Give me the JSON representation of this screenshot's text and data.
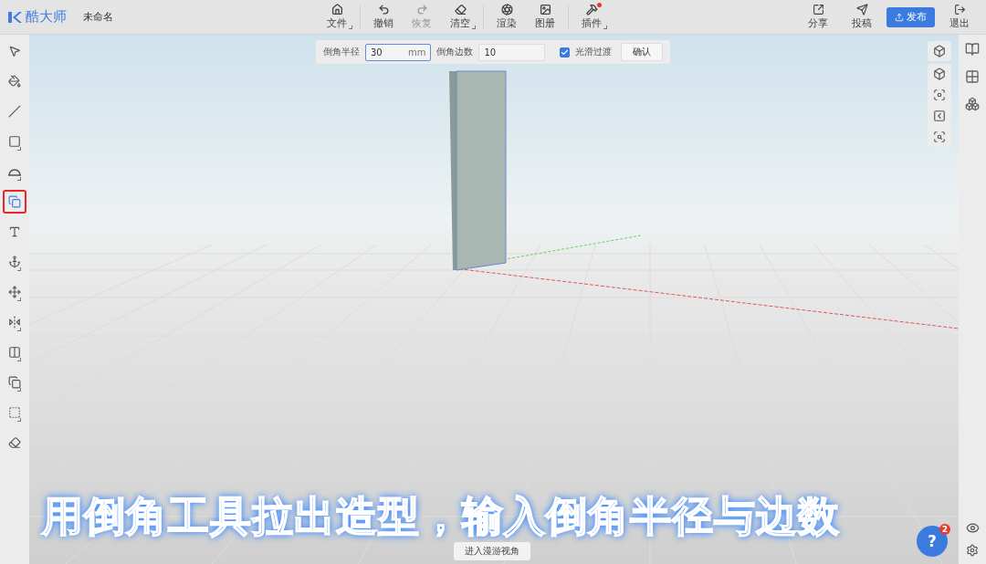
{
  "app": {
    "logo_text": "酷大师",
    "document_title": "未命名"
  },
  "toolbar": [
    {
      "label": "文件",
      "menu": true,
      "disabled": false,
      "badge": false
    },
    {
      "label": "撤销",
      "menu": false,
      "disabled": false,
      "badge": false
    },
    {
      "label": "恢复",
      "menu": false,
      "disabled": true,
      "badge": false
    },
    {
      "label": "清空",
      "menu": true,
      "disabled": false,
      "badge": false
    },
    {
      "label": "渲染",
      "menu": false,
      "disabled": false,
      "badge": false
    },
    {
      "label": "图册",
      "menu": false,
      "disabled": false,
      "badge": false
    },
    {
      "label": "插件",
      "menu": true,
      "disabled": false,
      "badge": true
    }
  ],
  "actions": [
    {
      "label": "分享"
    },
    {
      "label": "投稿"
    }
  ],
  "publish_button": "发布",
  "exit": {
    "label": "退出"
  },
  "tools": [
    {
      "selected": false,
      "menu": false
    },
    {
      "selected": false,
      "menu": false
    },
    {
      "selected": false,
      "menu": false
    },
    {
      "selected": false,
      "menu": true
    },
    {
      "selected": false,
      "menu": true
    },
    {
      "selected": true,
      "menu": false
    },
    {
      "selected": false,
      "menu": false
    },
    {
      "selected": false,
      "menu": true
    },
    {
      "selected": false,
      "menu": true
    },
    {
      "selected": false,
      "menu": true
    },
    {
      "selected": false,
      "menu": true
    },
    {
      "selected": false,
      "menu": true
    },
    {
      "selected": false,
      "menu": true
    },
    {
      "selected": false,
      "menu": false
    }
  ],
  "options_bar": {
    "radius_label": "倒角半径",
    "radius_value": "30",
    "radius_unit": "mm",
    "segments_label": "倒角边数",
    "segments_value": "10",
    "smooth": {
      "label": "光滑过渡",
      "checked": true
    },
    "confirm_button": "确认"
  },
  "roam_button": "进入漫游视角",
  "caption": "用倒角工具拉出造型，输入倒角半径与边数",
  "help": {
    "label": "?",
    "badge": "2"
  }
}
